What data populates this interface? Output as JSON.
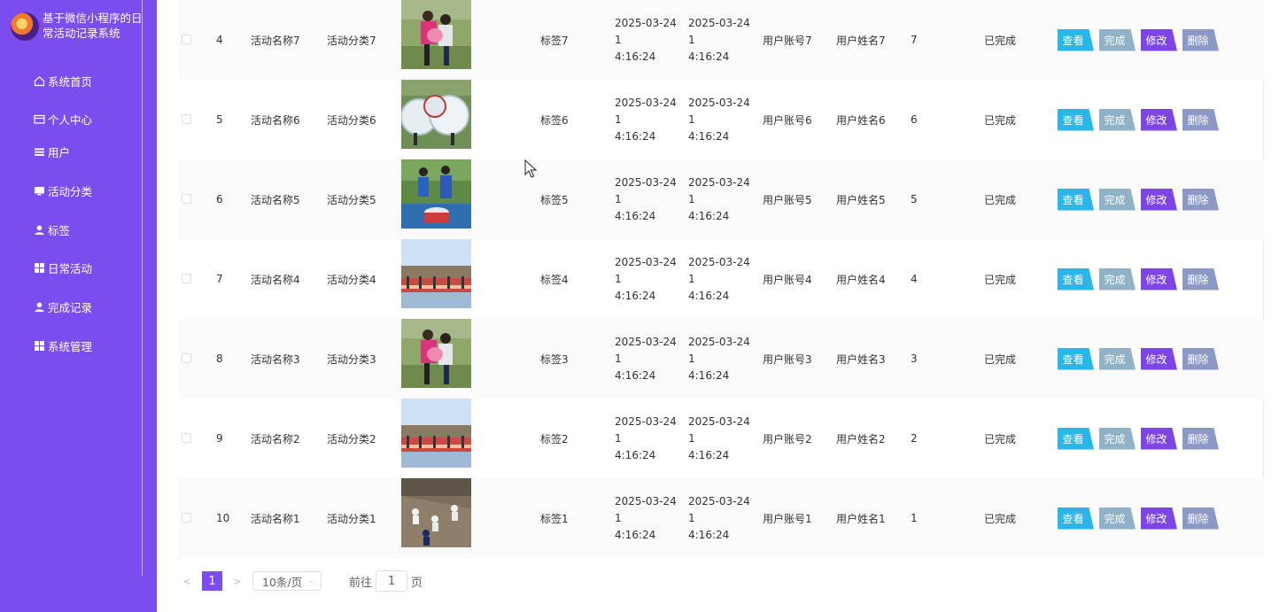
{
  "app": {
    "title": "基于微信小程序的日常活动记录系统"
  },
  "menu": [
    {
      "label": "系统首页",
      "icon": "home-icon"
    },
    {
      "label": "个人中心",
      "icon": "card-icon"
    },
    {
      "label": "用户",
      "icon": "list-icon"
    },
    {
      "label": "活动分类",
      "icon": "monitor-icon"
    },
    {
      "label": "标签",
      "icon": "user-icon"
    },
    {
      "label": "日常活动",
      "icon": "grid-icon"
    },
    {
      "label": "完成记录",
      "icon": "user-icon"
    },
    {
      "label": "系统管理",
      "icon": "grid-icon"
    }
  ],
  "table": {
    "rows": [
      {
        "idx": "4",
        "name": "活动名称7",
        "category": "活动分类7",
        "tag": "标签7",
        "time1a": "2025-03-24 1",
        "time1b": "4:16:24",
        "time2a": "2025-03-24 1",
        "time2b": "4:16:24",
        "account": "用户账号7",
        "username": "用户姓名7",
        "num": "7",
        "status": "已完成",
        "img": "hug"
      },
      {
        "idx": "5",
        "name": "活动名称6",
        "category": "活动分类6",
        "tag": "标签6",
        "time1a": "2025-03-24 1",
        "time1b": "4:16:24",
        "time2a": "2025-03-24 1",
        "time2b": "4:16:24",
        "account": "用户账号6",
        "username": "用户姓名6",
        "num": "6",
        "status": "已完成",
        "img": "bubble"
      },
      {
        "idx": "6",
        "name": "活动名称5",
        "category": "活动分类5",
        "tag": "标签5",
        "time1a": "2025-03-24 1",
        "time1b": "4:16:24",
        "time2a": "2025-03-24 1",
        "time2b": "4:16:24",
        "account": "用户账号5",
        "username": "用户姓名5",
        "num": "5",
        "status": "已完成",
        "img": "drum"
      },
      {
        "idx": "7",
        "name": "活动名称4",
        "category": "活动分类4",
        "tag": "标签4",
        "time1a": "2025-03-24 1",
        "time1b": "4:16:24",
        "time2a": "2025-03-24 1",
        "time2b": "4:16:24",
        "account": "用户账号4",
        "username": "用户姓名4",
        "num": "4",
        "status": "已完成",
        "img": "line"
      },
      {
        "idx": "8",
        "name": "活动名称3",
        "category": "活动分类3",
        "tag": "标签3",
        "time1a": "2025-03-24 1",
        "time1b": "4:16:24",
        "time2a": "2025-03-24 1",
        "time2b": "4:16:24",
        "account": "用户账号3",
        "username": "用户姓名3",
        "num": "3",
        "status": "已完成",
        "img": "hug"
      },
      {
        "idx": "9",
        "name": "活动名称2",
        "category": "活动分类2",
        "tag": "标签2",
        "time1a": "2025-03-24 1",
        "time1b": "4:16:24",
        "time2a": "2025-03-24 1",
        "time2b": "4:16:24",
        "account": "用户账号2",
        "username": "用户姓名2",
        "num": "2",
        "status": "已完成",
        "img": "line"
      },
      {
        "idx": "10",
        "name": "活动名称1",
        "category": "活动分类1",
        "tag": "标签1",
        "time1a": "2025-03-24 1",
        "time1b": "4:16:24",
        "time2a": "2025-03-24 1",
        "time2b": "4:16:24",
        "account": "用户账号1",
        "username": "用户姓名1",
        "num": "1",
        "status": "已完成",
        "img": "climb"
      }
    ]
  },
  "actions": {
    "view": "查看",
    "done": "完成",
    "edit": "修改",
    "delete": "删除"
  },
  "colors": {
    "sidebar": "#7c4dee",
    "view": "#29b6e8",
    "done": "#8fb2c9",
    "edit": "#7d45e8",
    "delete": "#8c98c6"
  },
  "pager": {
    "prev": "<",
    "page": "1",
    "next": ">",
    "size": "10条/页",
    "goto_prefix": "前往",
    "goto_value": "1",
    "goto_suffix": "页"
  }
}
